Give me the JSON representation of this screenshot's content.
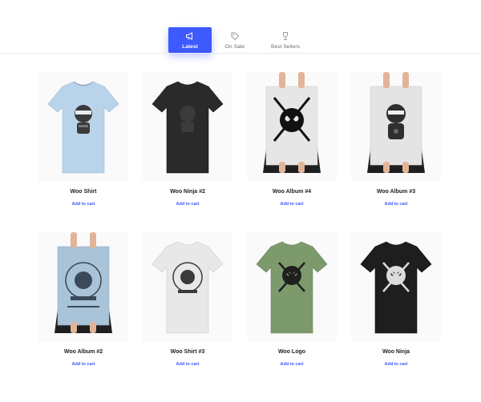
{
  "tabs": [
    {
      "label": "Latest",
      "icon": "megaphone-icon",
      "active": true
    },
    {
      "label": "On Sale",
      "icon": "tag-icon",
      "active": false
    },
    {
      "label": "Best Sellers",
      "icon": "trophy-icon",
      "active": false
    }
  ],
  "products": [
    {
      "title": "Woo Shirt",
      "action": "Add to cart",
      "image": "light-blue-ninja-tshirt",
      "color": "#b9d3ea"
    },
    {
      "title": "Woo Ninja #2",
      "action": "Add to cart",
      "image": "black-tshirt",
      "color": "#2a2a2a"
    },
    {
      "title": "Woo Album #4",
      "action": "Add to cart",
      "image": "skull-poster",
      "color": "#e6e6e6"
    },
    {
      "title": "Woo Album #3",
      "action": "Add to cart",
      "image": "ninja-poster",
      "color": "#e6e6e6"
    },
    {
      "title": "Woo Album #2",
      "action": "Add to cart",
      "image": "woothemes-poster",
      "color": "#a9c3d8"
    },
    {
      "title": "Woo Shirt #3",
      "action": "Add to cart",
      "image": "white-woothemes-tshirt",
      "color": "#e8e8e8"
    },
    {
      "title": "Woo Logo",
      "action": "Add to cart",
      "image": "green-skull-tshirt",
      "color": "#7d9a6c"
    },
    {
      "title": "Woo Ninja",
      "action": "Add to cart",
      "image": "black-skull-tshirt",
      "color": "#1e1e1e"
    }
  ],
  "colors": {
    "accent": "#3d5afe"
  }
}
